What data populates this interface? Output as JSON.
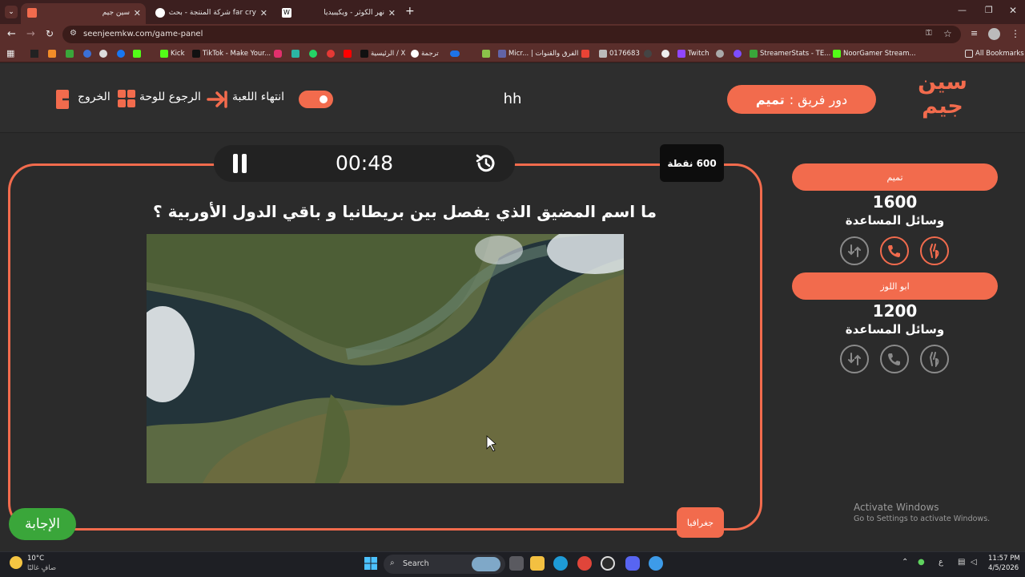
{
  "browser": {
    "tabs": [
      {
        "title": "سين جيم",
        "active": true
      },
      {
        "title": "far cry شركة المنتجة - بحث Google",
        "active": false
      },
      {
        "title": "نهر الكوثر - ويكيبيديا",
        "active": false
      }
    ],
    "url": "seenjeemkw.com/game-panel",
    "bookmarks": [
      "Kick",
      "TikTok - Make Your...",
      "الرئيسية / X",
      "ترجمة",
      "Micr... | الفرق والقنوات",
      "0176683",
      "Twitch",
      "StreamerStats - TE...",
      "NoorGamer Stream..."
    ],
    "all_bookmarks": "All Bookmarks"
  },
  "header": {
    "logo_line1": "سين",
    "logo_line2": "جيم",
    "turn_prefix": "دور فريق :",
    "turn_team": "تميم",
    "game_name": "hh",
    "end_game": "انتهاء اللعبة",
    "back_to_board": "الرجوع للوحة",
    "exit": "الخروج"
  },
  "question": {
    "timer": "00:48",
    "points": "600 نقطة",
    "text": "ما اسم المضيق الذي يفصل بين بريطانيا و باقي الدول الأوربية ؟",
    "category": "جغرافيا",
    "answer_button": "الإجابة"
  },
  "teams": [
    {
      "name": "تميم",
      "score": "1600",
      "aids_label": "وسائل المساعدة"
    },
    {
      "name": "ابو اللوز",
      "score": "1200",
      "aids_label": "وسائل المساعدة"
    }
  ],
  "watermark": {
    "title": "Activate Windows",
    "subtitle": "Go to Settings to activate Windows."
  },
  "taskbar": {
    "weather_temp": "10°C",
    "weather_desc": "صافٍ غالبًا",
    "search_placeholder": "Search",
    "lang": "ع",
    "time": "11:57 PM",
    "date": "4/5/2026"
  },
  "colors": {
    "accent": "#f26b4d",
    "answer_green": "#3aa63a",
    "background": "#2b2b2b"
  }
}
